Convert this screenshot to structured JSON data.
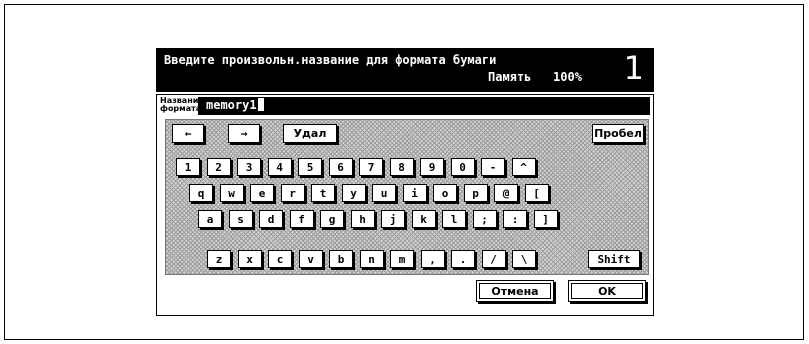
{
  "header": {
    "title": "Введите произвольн.название для формата бумаги",
    "memory_label": "Память",
    "memory_value": "100%",
    "page_number": "1"
  },
  "field": {
    "label_line1": "Название",
    "label_line2": "формата",
    "value": "memory1"
  },
  "keys": {
    "left_arrow": "←",
    "right_arrow": "→",
    "delete": "Удал",
    "space": "Пробел",
    "row1": [
      "1",
      "2",
      "3",
      "4",
      "5",
      "6",
      "7",
      "8",
      "9",
      "0",
      "-",
      "^"
    ],
    "row2": [
      "q",
      "w",
      "e",
      "r",
      "t",
      "y",
      "u",
      "i",
      "o",
      "p",
      "@",
      "["
    ],
    "row3": [
      "a",
      "s",
      "d",
      "f",
      "g",
      "h",
      "j",
      "k",
      "l",
      ";",
      ":",
      "]"
    ],
    "row4": [
      "z",
      "x",
      "c",
      "v",
      "b",
      "n",
      "m",
      ",",
      ".",
      "/",
      "\\"
    ],
    "shift": "Shift"
  },
  "actions": {
    "cancel": "Отмена",
    "ok": "OK"
  }
}
